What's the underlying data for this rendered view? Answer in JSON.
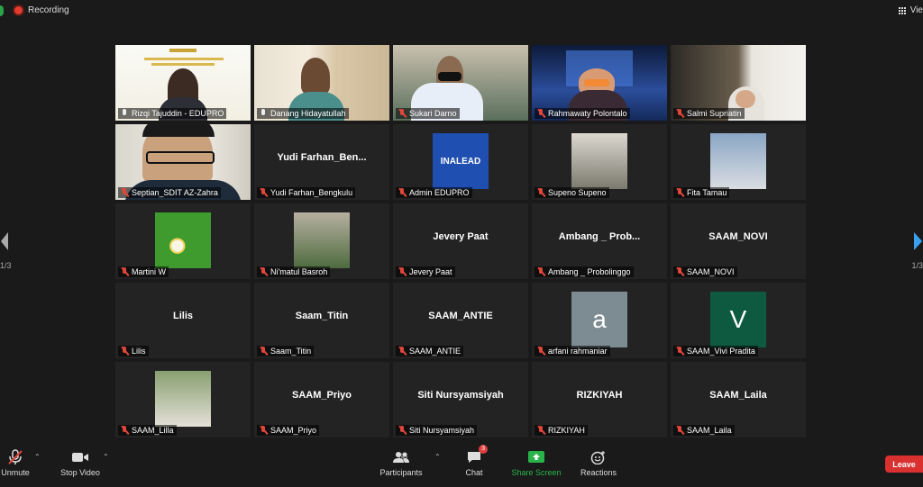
{
  "topbar": {
    "recording": "Recording",
    "view": "Vie"
  },
  "pager": {
    "left": "1/3",
    "right": "1/3"
  },
  "tiles": [
    {
      "name": "Rizqi Tajuddin - EDUPRO",
      "mic": "on"
    },
    {
      "name": "Danang Hidayatullah",
      "mic": "on",
      "active": true
    },
    {
      "name": "Sukari Darno",
      "mic": "off"
    },
    {
      "name": "Rahmawaty Polontalo",
      "mic": "off"
    },
    {
      "name": "Salmi Supriatin",
      "mic": "off"
    },
    {
      "name": "Septian_SDIT AZ-Zahra",
      "mic": "off"
    },
    {
      "name": "Yudi Farhan_Bengkulu",
      "display": "Yudi  Farhan_Ben...",
      "mic": "off"
    },
    {
      "name": "Admin EDUPRO",
      "mic": "off",
      "logo": "INALEAD"
    },
    {
      "name": "Supeno Supeno",
      "mic": "off"
    },
    {
      "name": "Fita Tamau",
      "mic": "off"
    },
    {
      "name": "Martini W",
      "mic": "off"
    },
    {
      "name": "Ni'matul Basroh",
      "mic": "off"
    },
    {
      "name": "Jevery Paat",
      "display": "Jevery Paat",
      "mic": "off"
    },
    {
      "name": "Ambang _ Probolinggo",
      "display": "Ambang _ Prob...",
      "mic": "off"
    },
    {
      "name": "SAAM_NOVI",
      "display": "SAAM_NOVI",
      "mic": "off"
    },
    {
      "name": "Lilis",
      "display": "Lilis",
      "mic": "off"
    },
    {
      "name": "Saam_Titin",
      "display": "Saam_Titin",
      "mic": "off"
    },
    {
      "name": "SAAM_ANTIE",
      "display": "SAAM_ANTIE",
      "mic": "off"
    },
    {
      "name": "arfani rahmaniar",
      "mic": "off",
      "avatar_letter": "a",
      "avatar_color": "#7d8c93"
    },
    {
      "name": "SAAM_Vivi Pradita",
      "mic": "off",
      "avatar_letter": "V",
      "avatar_color": "#0e5a40"
    },
    {
      "name": "SAAM_Lilla",
      "mic": "off"
    },
    {
      "name": "SAAM_Priyo",
      "display": "SAAM_Priyo",
      "mic": "off"
    },
    {
      "name": "Siti Nursyamsiyah",
      "display": "Siti Nursyamsiyah",
      "mic": "off"
    },
    {
      "name": "RIZKIYAH",
      "display": "RIZKIYAH",
      "mic": "off"
    },
    {
      "name": "SAAM_Laila",
      "display": "SAAM_Laila",
      "mic": "off"
    }
  ],
  "toolbar": {
    "unmute": "Unmute",
    "stop_video": "Stop Video",
    "participants": "Participants",
    "participants_count": "68",
    "chat": "Chat",
    "chat_badge": "3",
    "share_screen": "Share Screen",
    "reactions": "Reactions",
    "leave": "Leave"
  },
  "colors": {
    "share_green": "#2bb34b",
    "leave_red": "#d93030",
    "active_border": "#d7e54a",
    "muted_red": "#e0463a"
  }
}
